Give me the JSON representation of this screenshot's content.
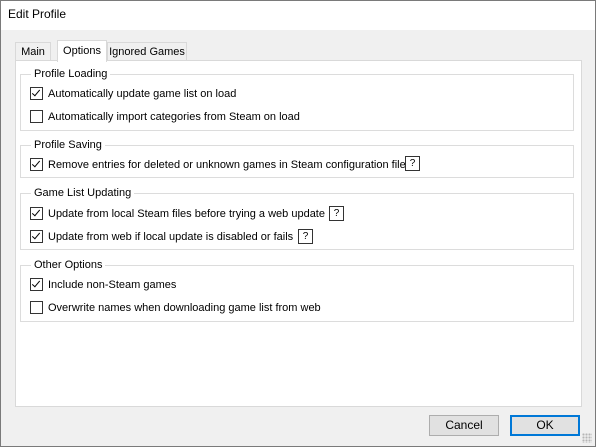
{
  "window": {
    "title": "Edit Profile"
  },
  "tabs": [
    {
      "label": "Main"
    },
    {
      "label": "Options"
    },
    {
      "label": "Ignored Games"
    }
  ],
  "active_tab": "Options",
  "groups": {
    "profile_loading": {
      "title": "Profile Loading",
      "options": [
        {
          "label": "Automatically update game list on load",
          "checked": true
        },
        {
          "label": "Automatically import categories from Steam on load",
          "checked": false
        }
      ]
    },
    "profile_saving": {
      "title": "Profile Saving",
      "options": [
        {
          "label": "Remove entries for deleted or unknown games in Steam configuration file",
          "checked": true
        }
      ]
    },
    "game_list_updating": {
      "title": "Game List Updating",
      "options": [
        {
          "label": "Update from local Steam files before trying a web update",
          "checked": true
        },
        {
          "label": "Update from web if local update is disabled or fails",
          "checked": true
        }
      ]
    },
    "other_options": {
      "title": "Other Options",
      "options": [
        {
          "label": "Include non-Steam games",
          "checked": true
        },
        {
          "label": "Overwrite names when downloading game list from web",
          "checked": false
        }
      ]
    }
  },
  "help_label": "?",
  "buttons": {
    "cancel": "Cancel",
    "ok": "OK"
  }
}
